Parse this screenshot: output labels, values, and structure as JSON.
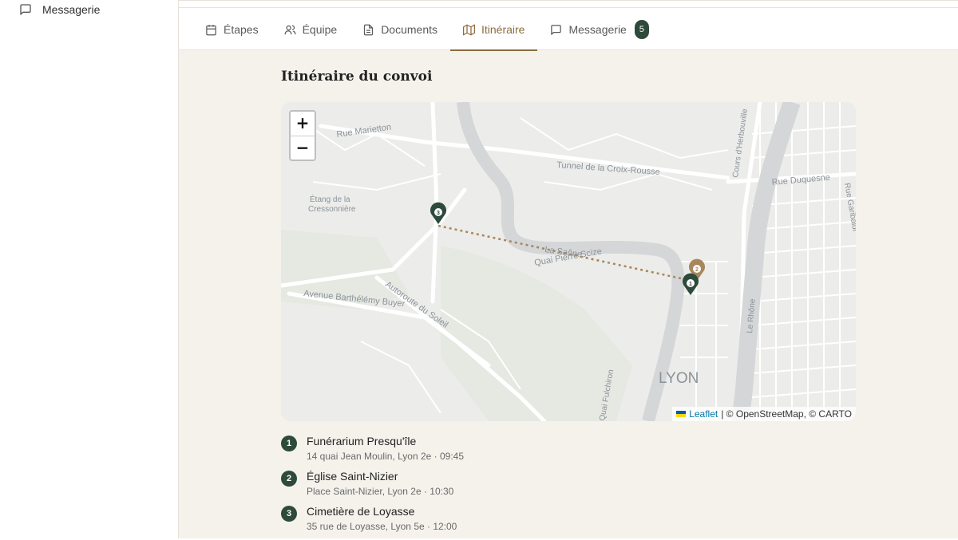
{
  "sidebar": {
    "items": [
      {
        "label": "Messagerie",
        "icon": "message-square-icon"
      }
    ]
  },
  "tabs": [
    {
      "label": "Étapes",
      "icon": "calendar-icon",
      "active": false
    },
    {
      "label": "Équipe",
      "icon": "users-icon",
      "active": false
    },
    {
      "label": "Documents",
      "icon": "file-text-icon",
      "active": false
    },
    {
      "label": "Itinéraire",
      "icon": "map-icon",
      "active": true
    },
    {
      "label": "Messagerie",
      "icon": "message-square-icon",
      "active": false,
      "badge": "5"
    }
  ],
  "main": {
    "title": "Itinéraire du convoi"
  },
  "map": {
    "zoom_in": "+",
    "zoom_out": "−",
    "street_labels": [
      "Rue Marietton",
      "Tunnel de la Croix-Rousse",
      "Rue Duquesne",
      "Étang de la",
      "Cressonnière",
      "La Saône",
      "Quai Pierre Scize",
      "Avenue Barthélémy Buyer",
      "Autoroute du Soleil",
      "LYON",
      "Cours d'Herbouville",
      "Le Rhône",
      "Rue Garibaldi",
      "Quai Fulchiron"
    ],
    "attribution_link": "Leaflet",
    "attribution_text": "| © OpenStreetMap, © CARTO",
    "marker_labels": [
      "1",
      "2",
      "3"
    ]
  },
  "stops": [
    {
      "num": "1",
      "name": "Funérarium Presqu'île",
      "detail": "14 quai Jean Moulin, Lyon 2e · 09:45"
    },
    {
      "num": "2",
      "name": "Église Saint-Nizier",
      "detail": "Place Saint-Nizier, Lyon 2e · 10:30"
    },
    {
      "num": "3",
      "name": "Cimetière de Loyasse",
      "detail": "35 rue de Loyasse, Lyon 5e · 12:00"
    }
  ],
  "colors": {
    "accent": "#8c6d3f",
    "marker_dark": "#2d4a3a",
    "marker_gold": "#a8875a",
    "background": "#f5f2ec"
  }
}
